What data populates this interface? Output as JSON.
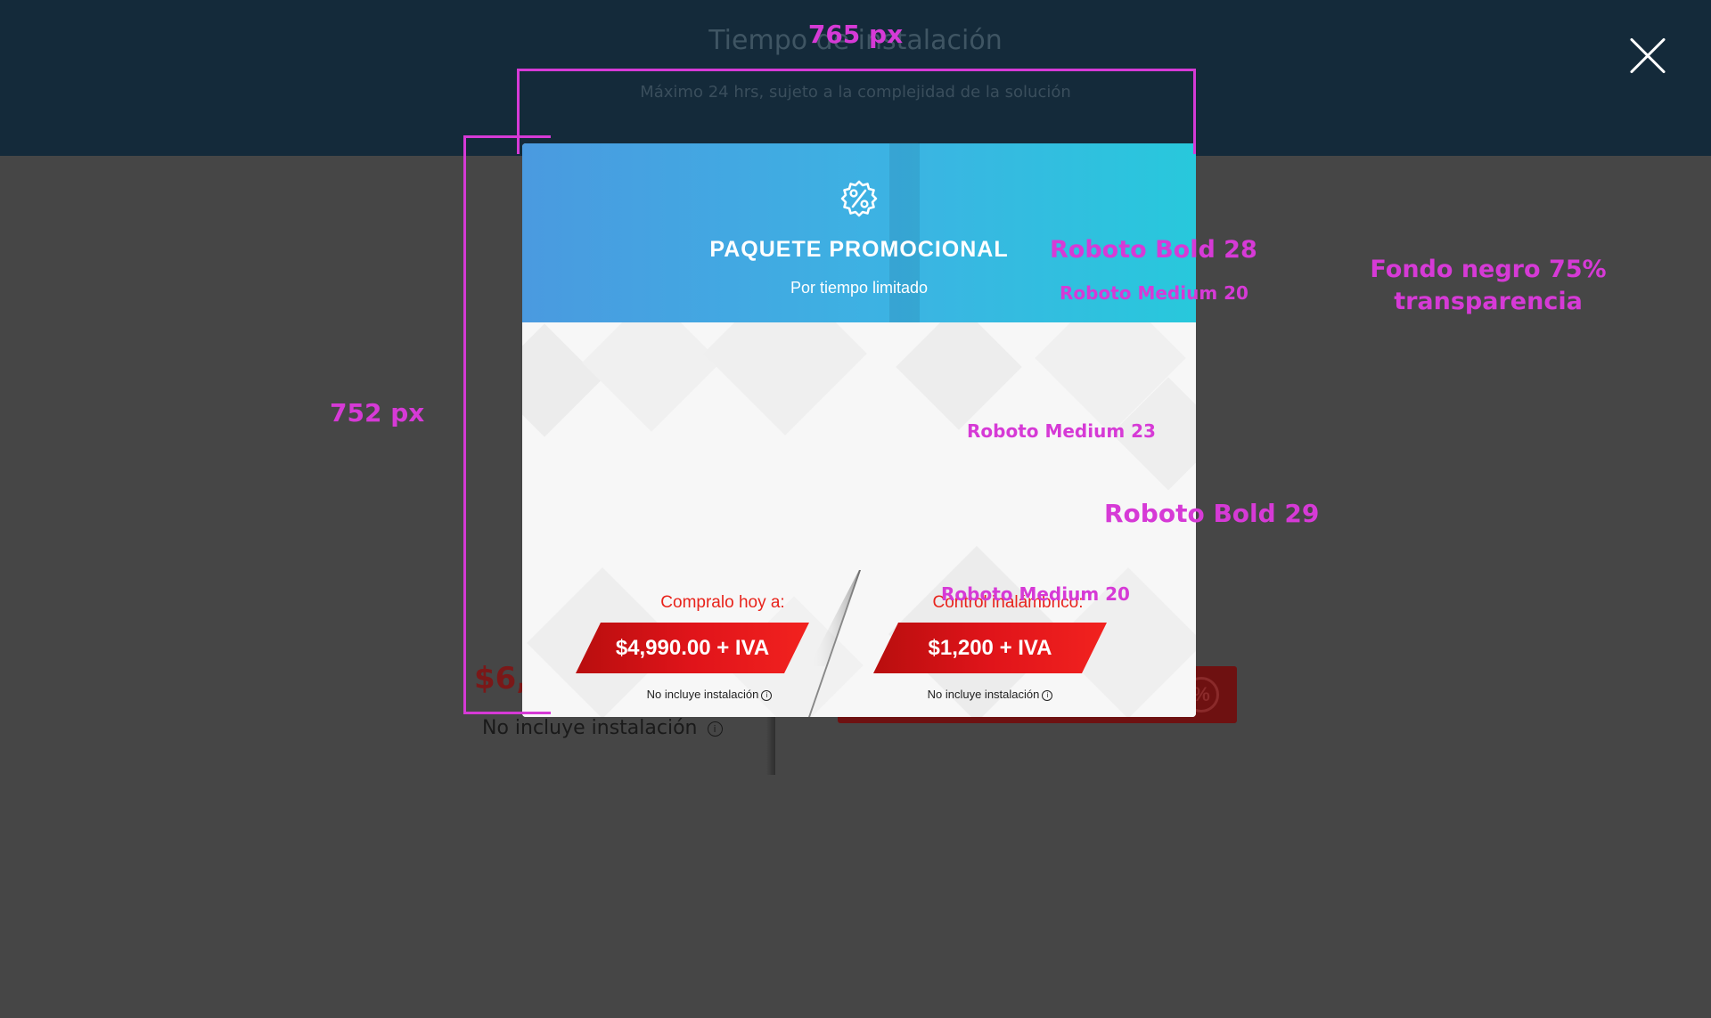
{
  "background_page": {
    "title": "Tiempo de instalación",
    "subtitle": "Máximo 24 hrs, sujeto a la complejidad de la solución",
    "price_partial": "$6,",
    "note": "No incluye instalación",
    "info_glyph": "i",
    "button_icon": "%"
  },
  "modal": {
    "icon": "percent-badge-icon",
    "title": "PAQUETE PROMOCIONAL",
    "subtitle": "Por tiempo limitado",
    "left": {
      "label": "Compralo hoy a:",
      "price": "$4,990.00 + IVA",
      "note": "No incluye instalación"
    },
    "right": {
      "label": "Control inalámbrico:",
      "price": "$1,200 + IVA",
      "note": "No incluye instalación"
    },
    "info_glyph": "i"
  },
  "annotations": {
    "width_label": "765 px",
    "height_label": "752 px",
    "title_font": "Roboto Bold 28",
    "subtitle_font": "Roboto Medium 20",
    "label_font": "Roboto Medium 23",
    "price_font": "Roboto Bold 29",
    "note_font": "Roboto Medium 20",
    "overlay_note_line1": "Fondo negro 75%",
    "overlay_note_line2": "transparencia"
  },
  "colors": {
    "overlay": "#464646",
    "accent_red": "#e8231b",
    "header_gradient_start": "#4a9ae0",
    "header_gradient_end": "#28c8dc",
    "annotation": "#d63ad6"
  }
}
